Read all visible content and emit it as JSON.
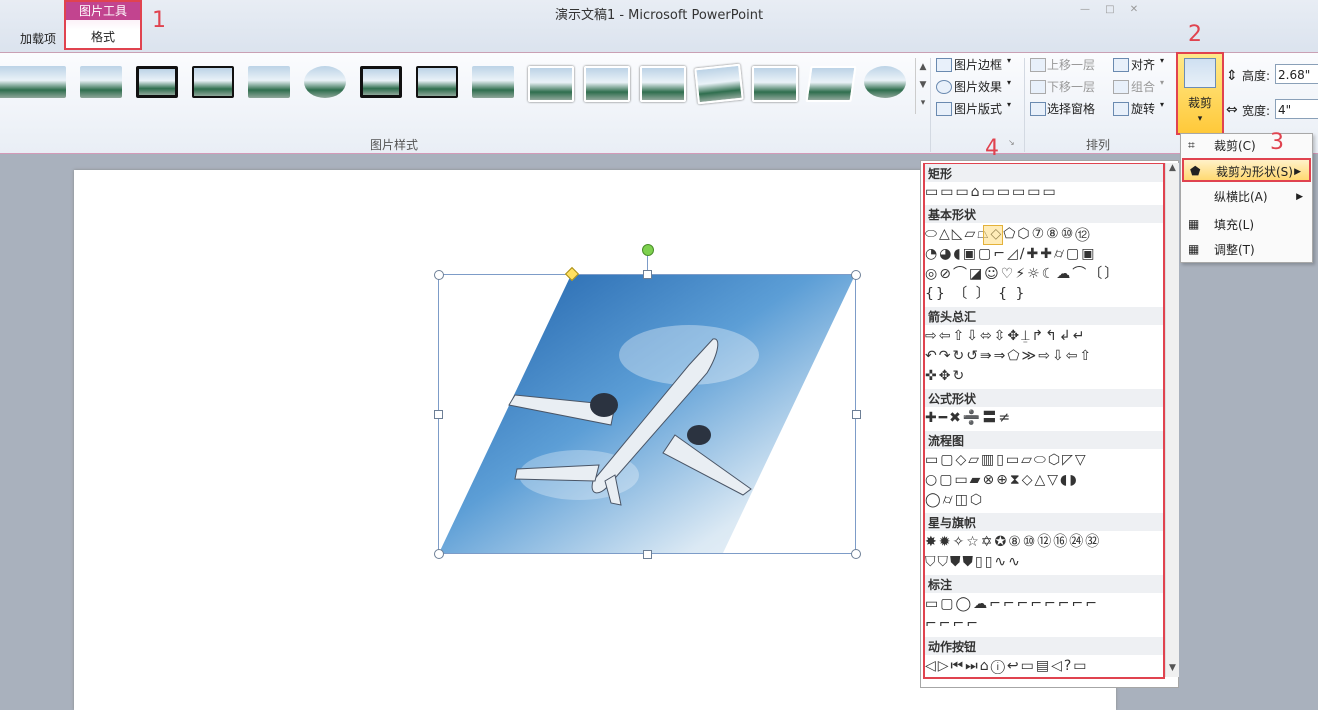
{
  "window": {
    "title": "演示文稿1  -  Microsoft PowerPoint"
  },
  "tabs": {
    "addins": "加载项",
    "context_group": "图片工具",
    "format": "格式"
  },
  "callouts": [
    "1",
    "2",
    "3",
    "4"
  ],
  "ribbon": {
    "picture_styles_group": "图片样式",
    "border": "图片边框",
    "effects": "图片效果",
    "layout": "图片版式",
    "arrange_group": "排列",
    "bring_forward": "上移一层",
    "send_backward": "下移一层",
    "selection_pane": "选择窗格",
    "align": "对齐",
    "group": "组合",
    "rotate": "旋转",
    "crop": "裁剪",
    "height_label": "高度:",
    "height_value": "2.68\"",
    "width_label": "宽度:",
    "width_value": "4\""
  },
  "crop_menu": {
    "crop": "裁剪(C)",
    "crop_to_shape": "裁剪为形状(S)",
    "aspect_ratio": "纵横比(A)",
    "fill": "填充(L)",
    "fit": "调整(T)"
  },
  "shapes_panel": {
    "categories": [
      "矩形",
      "基本形状",
      "箭头总汇",
      "公式形状",
      "流程图",
      "星与旗帜",
      "标注",
      "动作按钮"
    ],
    "rows": {
      "rect": "▭▭▭⌂▭▭▭▭▭",
      "basic1": "⬭△◺▱⏢◇⬠⬡⑦⑧⑩⑫",
      "basic2": "◔◕◖▣▢⌐◿∕✚✚⌭▢▣",
      "basic3": "◎⊘⌒◪☺♡⚡☼☾☁⌒〔〕",
      "basic4": "{} 〔 〕 {  }",
      "arrows1": "⇨⇦⇧⇩⬄⇳✥⍊↱↰↲↵",
      "arrows2": "↶↷↻↺⇛⇒⬠≫⇨⇩⇦⇧",
      "arrows3": "✜✥↻",
      "equation": "✚━✖➗〓≠",
      "flow1": "▭▢◇▱▥▯▭▱⬭⬡◸▽",
      "flow2": "○▢▭▰⊗⊕⧗◇△▽◖◗",
      "flow3": "◯⌭◫⬡",
      "stars1": "✸✹✧☆✡✪⑧⑩⑫⑯㉔㉜",
      "stars2": "⛉⛉⛊⛊▯▯∿∿",
      "callouts1": "▭▢◯☁⌐⌐⌐⌐⌐⌐⌐⌐",
      "callouts2": "⌐⌐⌐⌐",
      "action": "◁▷⏮⏭⌂ⓘ↩▭▤◁?▭"
    }
  },
  "colors": {
    "accent_red": "#e0434f",
    "context_pink": "#c2448f",
    "highlight": "#ffd971"
  }
}
